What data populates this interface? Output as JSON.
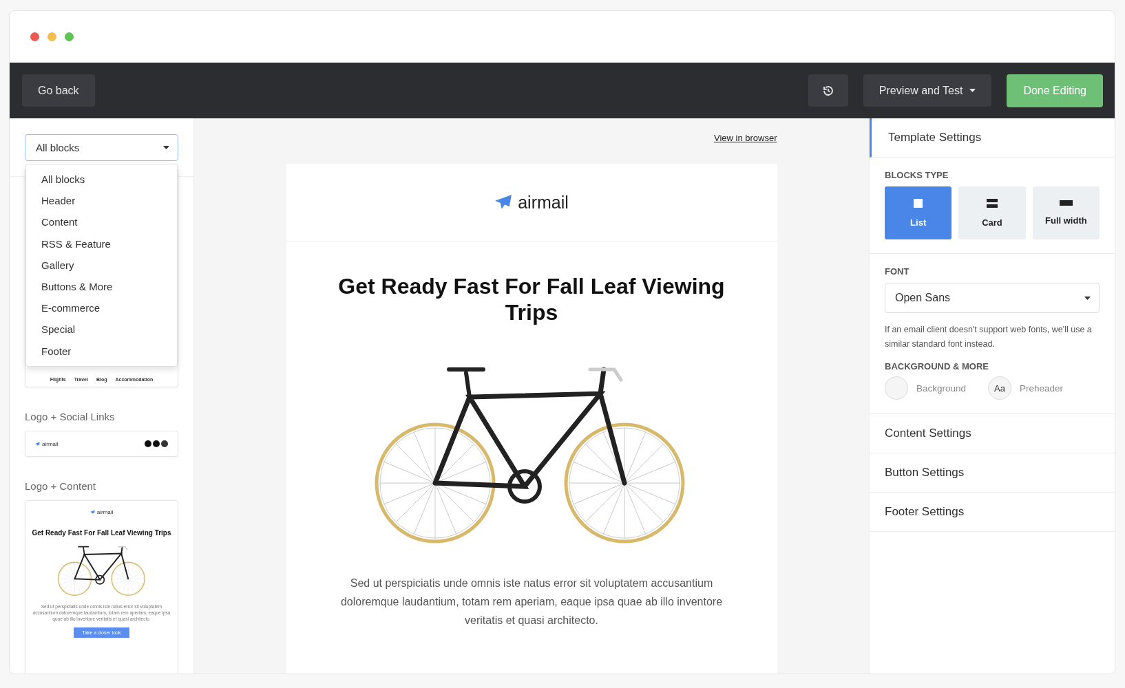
{
  "toolbar": {
    "back_button": "Go back",
    "preview_button": "Preview and Test",
    "done_button": "Done Editing"
  },
  "sidebar": {
    "filter": {
      "value": "All blocks",
      "expanded": true
    },
    "menu_items": [
      {
        "label": "All blocks",
        "selected": false
      },
      {
        "label": "Header",
        "selected": false
      },
      {
        "label": "Content",
        "selected": false
      },
      {
        "label": "RSS & Feature",
        "selected": false
      },
      {
        "label": "Gallery",
        "selected": false
      },
      {
        "label": "Buttons & More",
        "selected": false
      },
      {
        "label": "E-commerce",
        "selected": false
      },
      {
        "label": "Special",
        "selected": false
      },
      {
        "label": "Footer",
        "selected": false
      }
    ],
    "partial_block": {
      "links": [
        "Flights",
        "Travel",
        "Blog",
        "Accommodation"
      ]
    },
    "blocks": [
      {
        "kind": "social",
        "title": "Logo + Social Links",
        "logo": "airmail"
      },
      {
        "kind": "content",
        "title": "Logo + Content",
        "logo": "airmail",
        "heading": "Get Ready Fast For Fall Leaf Viewing Trips",
        "body": "Sed ut perspiciatis unde omnis iste natus error sit voluptatem accusantium doloremque laudantium, totam rem aperiam, eaque ipsa quae ab illo inventore veritatis et quasi architecto.",
        "button": "Take a closer look"
      }
    ]
  },
  "preview": {
    "view_link": "View in browser",
    "logo": "airmail",
    "heading": "Get Ready Fast For Fall Leaf Viewing Trips",
    "body": "Sed ut perspiciatis unde omnis iste natus error sit voluptatem accusantium doloremque laudantium, totam rem aperiam, eaque ipsa quae ab illo inventore veritatis et quasi architecto."
  },
  "settings": {
    "panels": [
      {
        "title": "Template Settings",
        "expanded": true
      },
      {
        "title": "Content Settings",
        "expanded": false
      },
      {
        "title": "Button Settings",
        "expanded": false
      },
      {
        "title": "Footer Settings",
        "expanded": false
      }
    ],
    "template": {
      "blocks_type": {
        "label": "BLOCKS TYPE",
        "options": [
          {
            "kind": "list",
            "label": "List",
            "selected": true
          },
          {
            "kind": "card",
            "label": "Card",
            "selected": false
          },
          {
            "kind": "full",
            "label": "Full width",
            "selected": false
          }
        ]
      },
      "font": {
        "label": "FONT",
        "value": "Open Sans",
        "hint": "If an email client doesn't support web fonts, we'll use a similar standard font instead."
      },
      "background": {
        "label": "BACKGROUND & MORE",
        "items": [
          {
            "kind": "swatch",
            "label": "Background"
          },
          {
            "kind": "text",
            "label": "Preheader",
            "swatch_text": "Aa"
          }
        ]
      }
    }
  }
}
